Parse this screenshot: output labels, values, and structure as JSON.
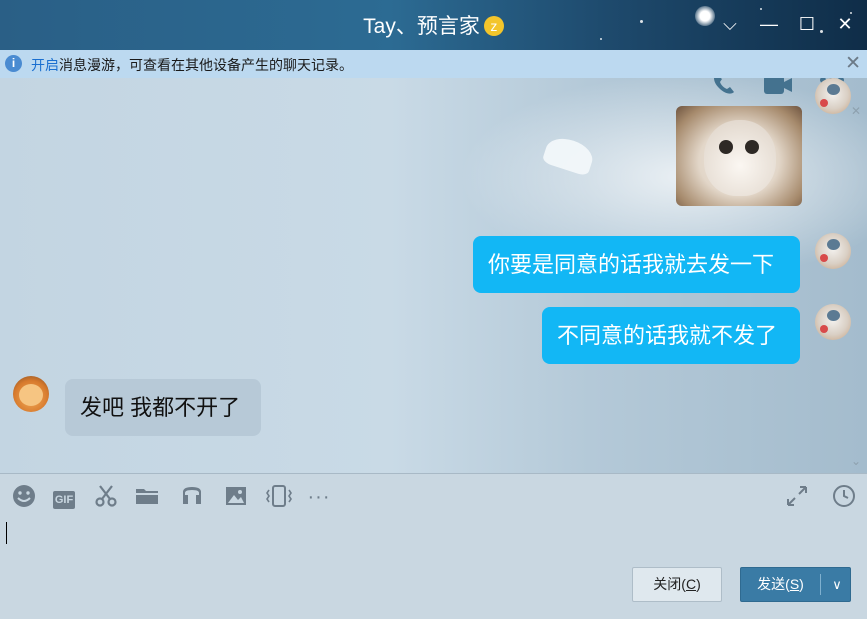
{
  "window": {
    "title": "Tay、预言家",
    "title_badge": "z",
    "controls": {
      "expand": "⌵",
      "minimize": "—",
      "maximize": "☐",
      "close": "✕"
    }
  },
  "notice": {
    "link": "开启",
    "text": "消息漫游，可查看在其他设备产生的聊天记录。",
    "close": "✕"
  },
  "messages": [
    {
      "side": "out",
      "type": "image",
      "description": "cat sticker"
    },
    {
      "side": "out",
      "type": "text",
      "text": "你要是同意的话我就去发一下"
    },
    {
      "side": "out",
      "type": "text",
      "text": "不同意的话我就不发了"
    },
    {
      "side": "in",
      "type": "text",
      "text": "发吧 我都不开了"
    }
  ],
  "chat_header_icons": [
    "phone-icon",
    "video-icon",
    "more-icon"
  ],
  "toolbar": {
    "tools": [
      "emoji-icon",
      "gif-icon",
      "scissors-icon",
      "folder-icon",
      "music-icon",
      "image-icon",
      "shake-icon",
      "more-icon"
    ],
    "right_tools": [
      "expand-icon",
      "history-clock-icon"
    ],
    "gif_label": "GIF",
    "more_label": "···"
  },
  "buttons": {
    "close_label": "关闭(",
    "close_key": "C",
    "close_end": ")",
    "send_label": "发送(",
    "send_key": "S",
    "send_end": ")",
    "send_dropdown": "∨"
  },
  "colors": {
    "outgoing_bubble": "#12b7f5",
    "incoming_bubble": "#b7c9d7",
    "title_bar": "#2c6b93",
    "notice_bar": "#bcd9f0"
  }
}
